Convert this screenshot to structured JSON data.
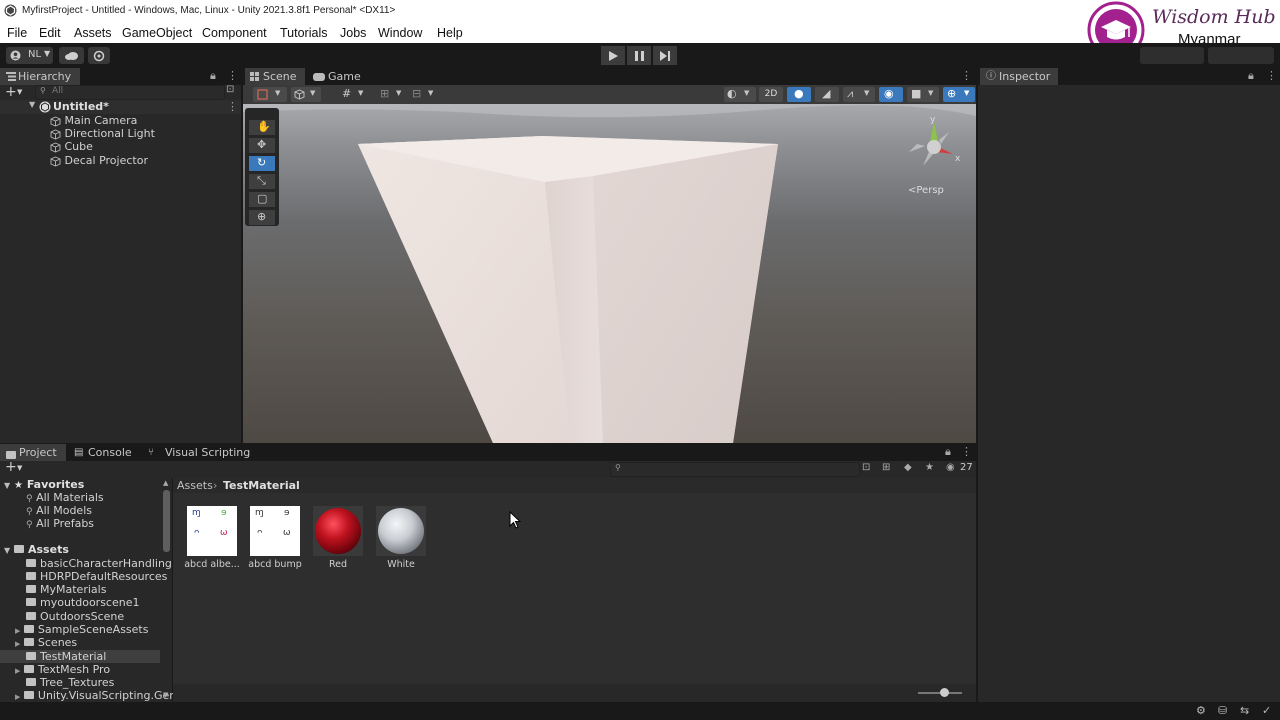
{
  "window_title": "MyfirstProject - Untitled - Windows, Mac, Linux - Unity 2021.3.8f1 Personal* <DX11>",
  "menu": [
    "File",
    "Edit",
    "Assets",
    "GameObject",
    "Component",
    "Tutorials",
    "Jobs",
    "Window",
    "Help"
  ],
  "watermark": {
    "line1": "Wisdom Hub",
    "line2": "Myanmar"
  },
  "toolbar": {
    "account_label": "NL"
  },
  "hierarchy": {
    "tab_label": "Hierarchy",
    "search_placeholder": "All",
    "scene_name": "Untitled*",
    "items": [
      "Main Camera",
      "Directional Light",
      "Cube",
      "Decal Projector"
    ]
  },
  "scene_tabs": {
    "scene": "Scene",
    "game": "Game"
  },
  "scene_view": {
    "btn_2d": "2D",
    "persp_label": "<Persp",
    "gizmo_axes": {
      "y": "y",
      "x": "x"
    }
  },
  "inspector": {
    "tab_label": "Inspector"
  },
  "bottom_tabs": {
    "project": "Project",
    "console": "Console",
    "vsg": "Visual Scripting Graph"
  },
  "project": {
    "hidden_count": "27",
    "favorites_label": "Favorites",
    "favorites": [
      "All Materials",
      "All Models",
      "All Prefabs"
    ],
    "assets_label": "Assets",
    "folders": [
      "basicCharacterHandling",
      "HDRPDefaultResources",
      "MyMaterials",
      "myoutdoorscene1",
      "OutdoorsScene",
      "SampleSceneAssets",
      "Scenes",
      "TestMaterial",
      "TextMesh Pro",
      "Tree_Textures",
      "Unity.VisualScripting.Gen"
    ],
    "breadcrumb": {
      "root": "Assets",
      "current": "TestMaterial"
    },
    "assets": [
      {
        "name": "abcd albe...",
        "kind": "texture"
      },
      {
        "name": "abcd bump",
        "kind": "texture"
      },
      {
        "name": "Red",
        "kind": "material",
        "color": "#c0131f"
      },
      {
        "name": "White",
        "kind": "material",
        "color": "#d9dde2"
      }
    ]
  },
  "colors": {
    "accent": "#3a79bb",
    "logo": "#a3208f",
    "selected_row": "#2c5d87"
  }
}
